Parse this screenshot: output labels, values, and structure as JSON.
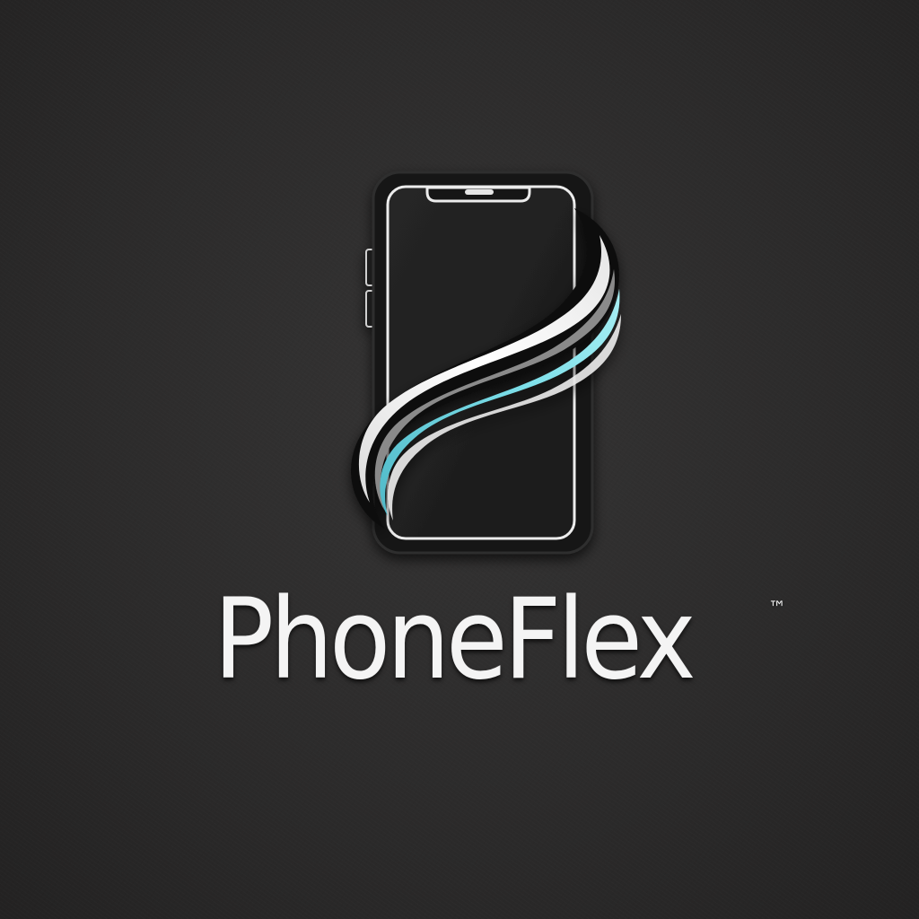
{
  "brand": {
    "name": "PhoneFlex",
    "trademark": "™"
  },
  "logo": {
    "icon": "smartphone-icon",
    "accent_icon": "swoosh-ribbon-icon"
  },
  "colors": {
    "background": "#2c2b2b",
    "phone_body": "#161616",
    "phone_screen": "#222222",
    "outline": "#e8e8e8",
    "ribbon_white": "#f2f2f2",
    "ribbon_grey": "#8a8a8a",
    "ribbon_cyan": "#6fd3e0",
    "text": "#f4f4f4"
  }
}
